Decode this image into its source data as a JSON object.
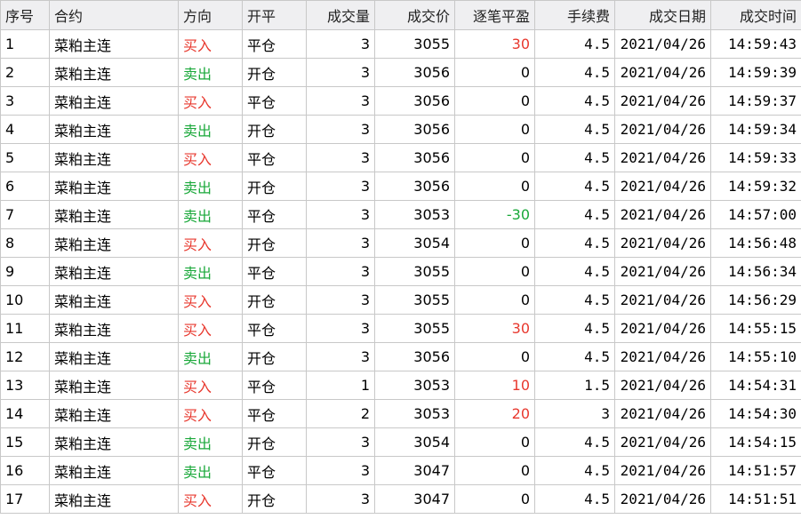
{
  "columns": [
    "序号",
    "合约",
    "方向",
    "开平",
    "成交量",
    "成交价",
    "逐笔平盈",
    "手续费",
    "成交日期",
    "成交时间"
  ],
  "colors": {
    "buy": "#e8382e",
    "sell": "#1aa83a",
    "profit": "#e8382e",
    "loss": "#1aa83a",
    "header_bg": "#efeff1",
    "grid": "#c8c8c8"
  },
  "rows": [
    {
      "seq": "1",
      "contract": "菜粕主连",
      "direction": "买入",
      "offset": "平仓",
      "volume": "3",
      "price": "3055",
      "pnl": "30",
      "fee": "4.5",
      "date": "2021/04/26",
      "time": "14:59:43"
    },
    {
      "seq": "2",
      "contract": "菜粕主连",
      "direction": "卖出",
      "offset": "开仓",
      "volume": "3",
      "price": "3056",
      "pnl": "0",
      "fee": "4.5",
      "date": "2021/04/26",
      "time": "14:59:39"
    },
    {
      "seq": "3",
      "contract": "菜粕主连",
      "direction": "买入",
      "offset": "平仓",
      "volume": "3",
      "price": "3056",
      "pnl": "0",
      "fee": "4.5",
      "date": "2021/04/26",
      "time": "14:59:37"
    },
    {
      "seq": "4",
      "contract": "菜粕主连",
      "direction": "卖出",
      "offset": "开仓",
      "volume": "3",
      "price": "3056",
      "pnl": "0",
      "fee": "4.5",
      "date": "2021/04/26",
      "time": "14:59:34"
    },
    {
      "seq": "5",
      "contract": "菜粕主连",
      "direction": "买入",
      "offset": "平仓",
      "volume": "3",
      "price": "3056",
      "pnl": "0",
      "fee": "4.5",
      "date": "2021/04/26",
      "time": "14:59:33"
    },
    {
      "seq": "6",
      "contract": "菜粕主连",
      "direction": "卖出",
      "offset": "开仓",
      "volume": "3",
      "price": "3056",
      "pnl": "0",
      "fee": "4.5",
      "date": "2021/04/26",
      "time": "14:59:32"
    },
    {
      "seq": "7",
      "contract": "菜粕主连",
      "direction": "卖出",
      "offset": "平仓",
      "volume": "3",
      "price": "3053",
      "pnl": "-30",
      "fee": "4.5",
      "date": "2021/04/26",
      "time": "14:57:00"
    },
    {
      "seq": "8",
      "contract": "菜粕主连",
      "direction": "买入",
      "offset": "开仓",
      "volume": "3",
      "price": "3054",
      "pnl": "0",
      "fee": "4.5",
      "date": "2021/04/26",
      "time": "14:56:48"
    },
    {
      "seq": "9",
      "contract": "菜粕主连",
      "direction": "卖出",
      "offset": "平仓",
      "volume": "3",
      "price": "3055",
      "pnl": "0",
      "fee": "4.5",
      "date": "2021/04/26",
      "time": "14:56:34"
    },
    {
      "seq": "10",
      "contract": "菜粕主连",
      "direction": "买入",
      "offset": "开仓",
      "volume": "3",
      "price": "3055",
      "pnl": "0",
      "fee": "4.5",
      "date": "2021/04/26",
      "time": "14:56:29"
    },
    {
      "seq": "11",
      "contract": "菜粕主连",
      "direction": "买入",
      "offset": "平仓",
      "volume": "3",
      "price": "3055",
      "pnl": "30",
      "fee": "4.5",
      "date": "2021/04/26",
      "time": "14:55:15"
    },
    {
      "seq": "12",
      "contract": "菜粕主连",
      "direction": "卖出",
      "offset": "开仓",
      "volume": "3",
      "price": "3056",
      "pnl": "0",
      "fee": "4.5",
      "date": "2021/04/26",
      "time": "14:55:10"
    },
    {
      "seq": "13",
      "contract": "菜粕主连",
      "direction": "买入",
      "offset": "平仓",
      "volume": "1",
      "price": "3053",
      "pnl": "10",
      "fee": "1.5",
      "date": "2021/04/26",
      "time": "14:54:31"
    },
    {
      "seq": "14",
      "contract": "菜粕主连",
      "direction": "买入",
      "offset": "平仓",
      "volume": "2",
      "price": "3053",
      "pnl": "20",
      "fee": "3",
      "date": "2021/04/26",
      "time": "14:54:30"
    },
    {
      "seq": "15",
      "contract": "菜粕主连",
      "direction": "卖出",
      "offset": "开仓",
      "volume": "3",
      "price": "3054",
      "pnl": "0",
      "fee": "4.5",
      "date": "2021/04/26",
      "time": "14:54:15"
    },
    {
      "seq": "16",
      "contract": "菜粕主连",
      "direction": "卖出",
      "offset": "平仓",
      "volume": "3",
      "price": "3047",
      "pnl": "0",
      "fee": "4.5",
      "date": "2021/04/26",
      "time": "14:51:57"
    },
    {
      "seq": "17",
      "contract": "菜粕主连",
      "direction": "买入",
      "offset": "开仓",
      "volume": "3",
      "price": "3047",
      "pnl": "0",
      "fee": "4.5",
      "date": "2021/04/26",
      "time": "14:51:51"
    }
  ]
}
